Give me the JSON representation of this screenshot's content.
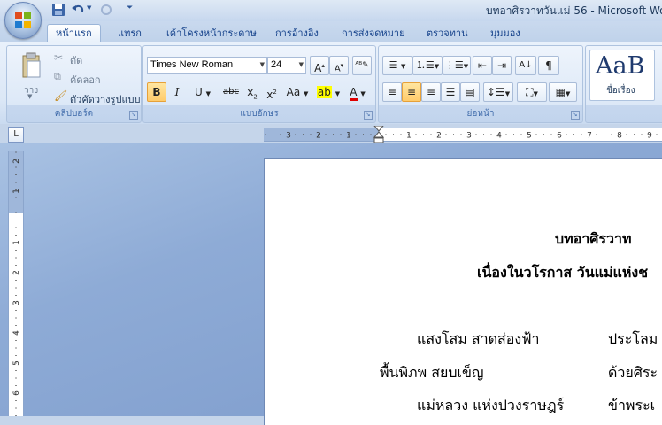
{
  "window": {
    "title": "บทอาศิรวาทวันแม่ 56 - Microsoft Wo"
  },
  "tabs": [
    {
      "label": "หน้าแรก",
      "active": true
    },
    {
      "label": "แทรก"
    },
    {
      "label": "เค้าโครงหน้ากระดาษ"
    },
    {
      "label": "การอ้างอิง"
    },
    {
      "label": "การส่งจดหมาย"
    },
    {
      "label": "ตรวจทาน"
    },
    {
      "label": "มุมมอง"
    }
  ],
  "clipboard": {
    "group_label": "คลิปบอร์ด",
    "paste_label": "วาง",
    "cut_label": "ตัด",
    "copy_label": "คัดลอก",
    "format_painter_label": "ตัวคัดวางรูปแบบ"
  },
  "font": {
    "group_label": "แบบอักษร",
    "font_name": "Times New Roman",
    "font_size": "24"
  },
  "paragraph": {
    "group_label": "ย่อหน้า"
  },
  "styles": {
    "sample": "AaB",
    "style_name": "ชื่อเรื่อง"
  },
  "document": {
    "lines": [
      "บทอาศิรวาท",
      "เนื่องในวโรกาส วันแม่แห่งช",
      "แสงโสม สาดส่องฟ้า",
      "ประโลม",
      "พื้นพิภพ สยบเข็ญ",
      "ด้วยศิระ",
      "แม่หลวง แห่งปวงราษฎร์",
      "ข้าพระเ"
    ]
  },
  "ruler": {
    "h_numbers": [
      "3",
      "2",
      "1",
      "1",
      "2",
      "3",
      "4",
      "5",
      "6",
      "7",
      "8",
      "9"
    ],
    "v_numbers": [
      "2",
      "1",
      "1",
      "2",
      "3",
      "4",
      "5",
      "6"
    ]
  }
}
